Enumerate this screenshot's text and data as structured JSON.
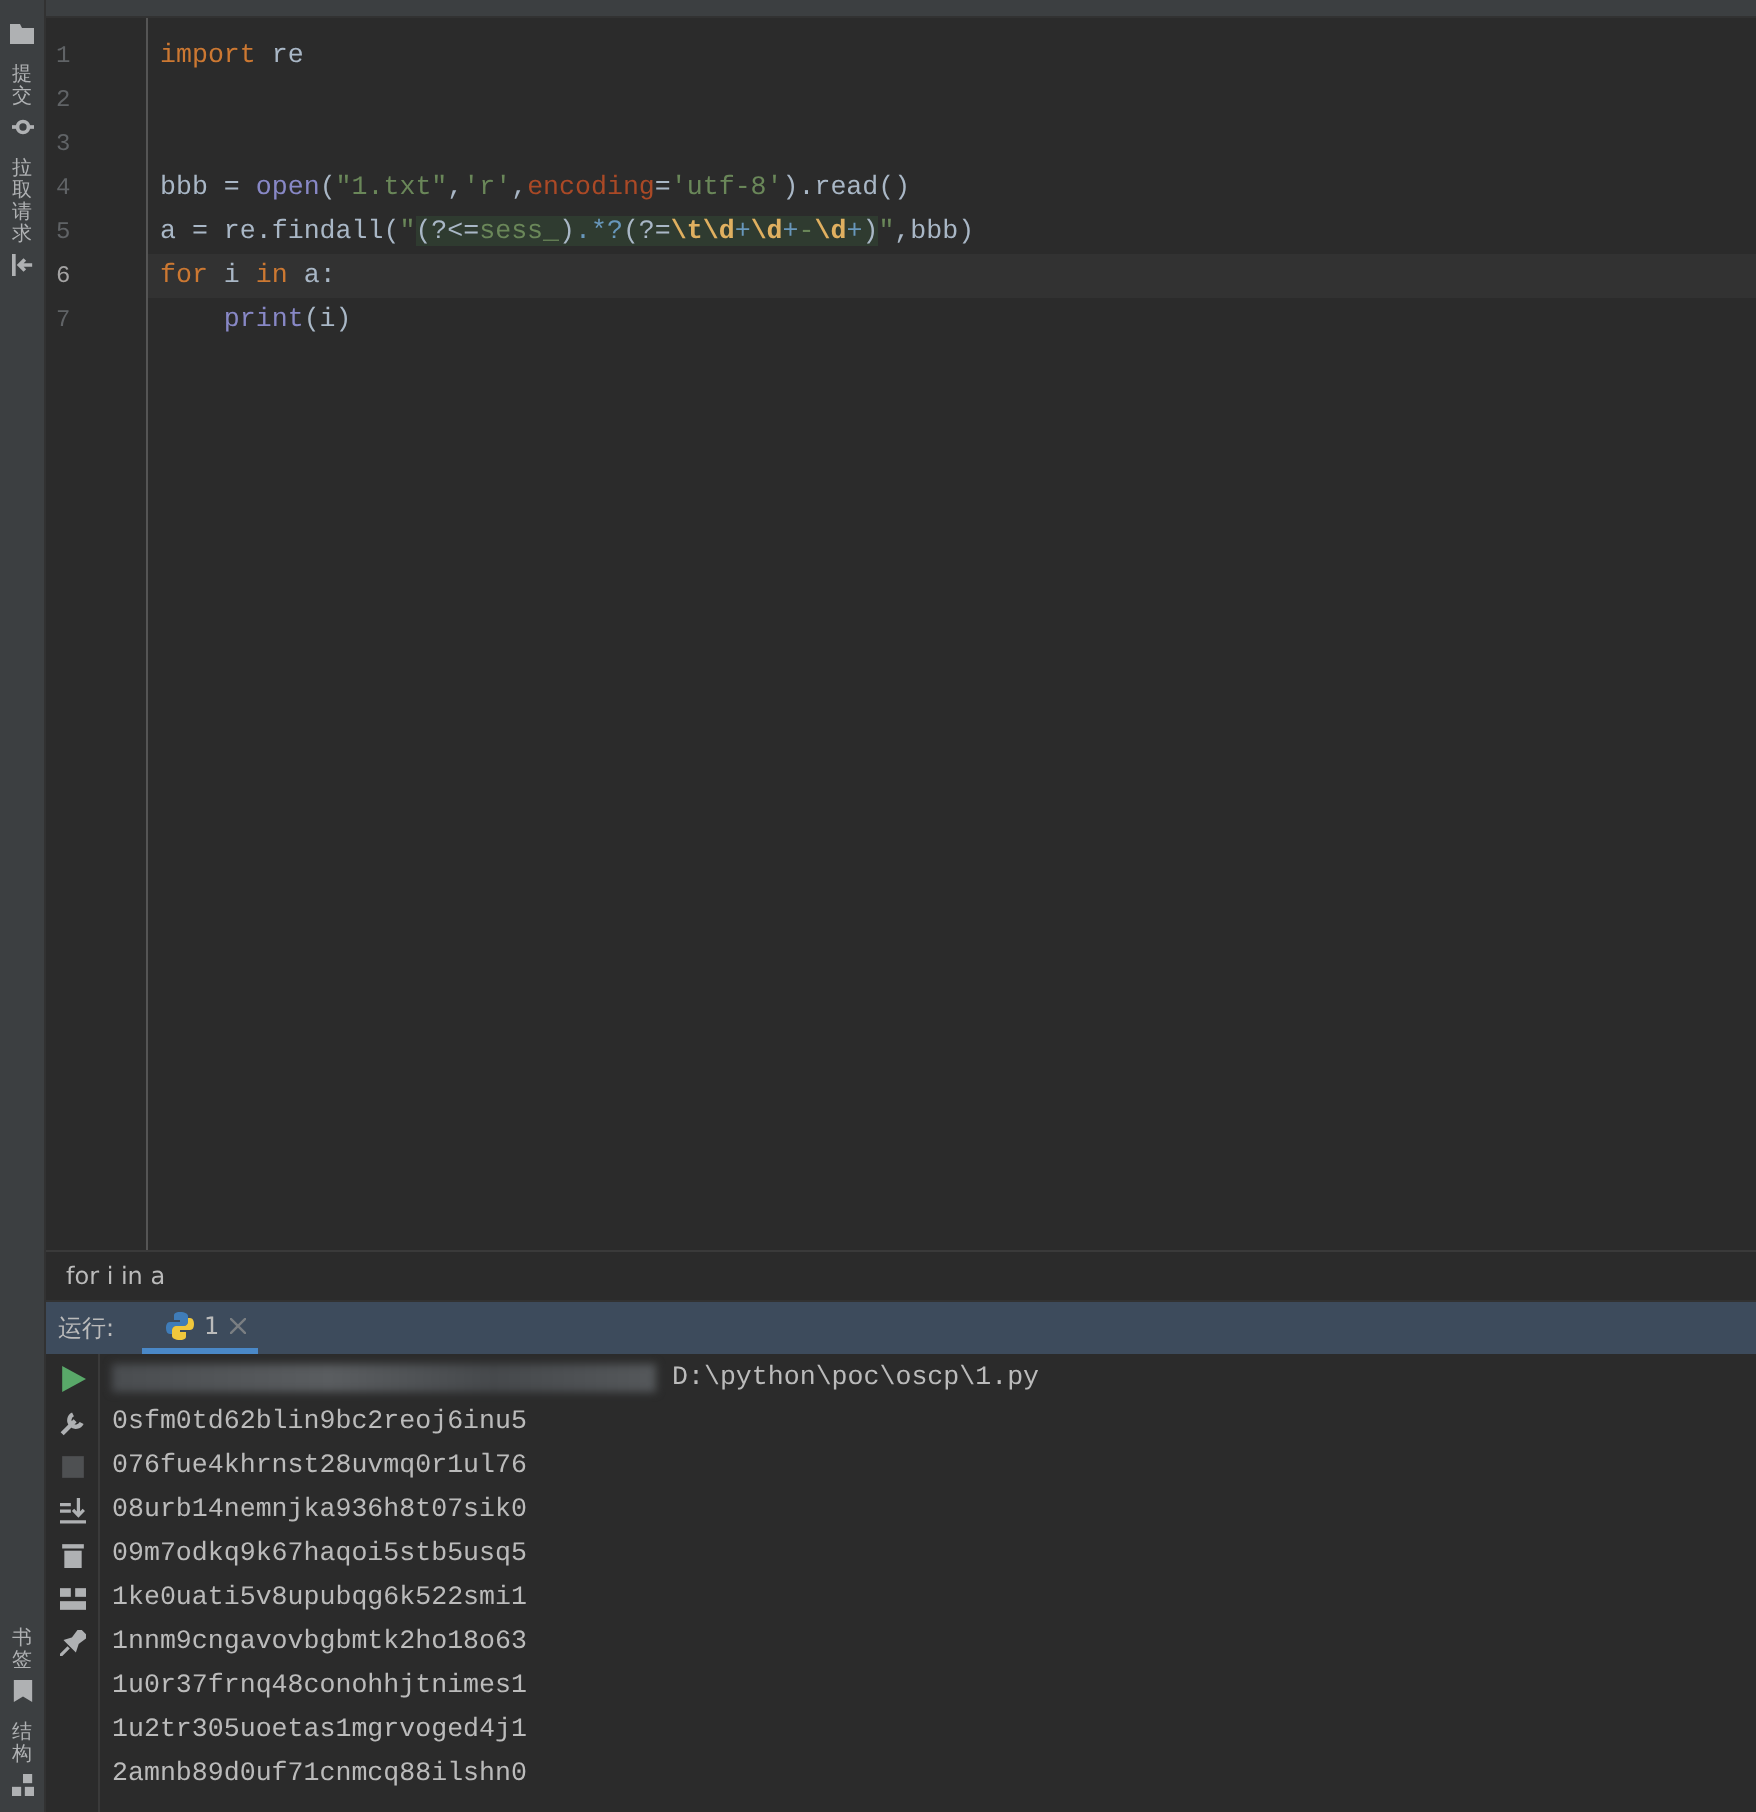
{
  "side_tools": {
    "top": [
      {
        "label": "提交",
        "kind": "commit"
      },
      {
        "label": "拉取请求",
        "kind": "pull"
      }
    ],
    "bottom": [
      {
        "label": "书签",
        "kind": "bookmark"
      },
      {
        "label": "结构",
        "kind": "structure"
      }
    ]
  },
  "editor": {
    "lines": [
      {
        "number": "1",
        "current": false,
        "tokens": [
          {
            "text": "import",
            "kind": "keyword"
          },
          {
            "text": " re",
            "kind": "plain"
          }
        ]
      },
      {
        "number": "2",
        "current": false
      },
      {
        "number": "3",
        "current": false
      },
      {
        "number": "4",
        "current": false,
        "tokens": [
          {
            "text": "bbb = ",
            "kind": "plain"
          },
          {
            "text": "open",
            "kind": "builtin"
          },
          {
            "text": "(",
            "kind": "plain"
          },
          {
            "text": "\"1.txt\"",
            "kind": "string"
          },
          {
            "text": ",",
            "kind": "plain"
          },
          {
            "text": "'r'",
            "kind": "string"
          },
          {
            "text": ",",
            "kind": "plain"
          },
          {
            "text": "encoding",
            "kind": "param"
          },
          {
            "text": "=",
            "kind": "plain"
          },
          {
            "text": "'utf-8'",
            "kind": "string"
          },
          {
            "text": ").read()",
            "kind": "plain"
          }
        ]
      },
      {
        "number": "5",
        "current": false,
        "tokens": [
          {
            "text": "a = re.findall(",
            "kind": "plain"
          },
          {
            "text": "\"",
            "kind": "string"
          },
          {
            "text": "(?<=",
            "kind": "regex-group"
          },
          {
            "text": "sess_",
            "kind": "regex-text"
          },
          {
            "text": ")",
            "kind": "regex-group"
          },
          {
            "text": ".*?",
            "kind": "regex-op"
          },
          {
            "text": "(?=",
            "kind": "regex-group"
          },
          {
            "text": "\\t\\d",
            "kind": "regex-escape"
          },
          {
            "text": "+",
            "kind": "regex-op"
          },
          {
            "text": "\\d",
            "kind": "regex-escape"
          },
          {
            "text": "+",
            "kind": "regex-op"
          },
          {
            "text": "-",
            "kind": "regex-text"
          },
          {
            "text": "\\d",
            "kind": "regex-escape"
          },
          {
            "text": "+",
            "kind": "regex-op"
          },
          {
            "text": ")",
            "kind": "regex-group"
          },
          {
            "text": "\"",
            "kind": "string"
          },
          {
            "text": ",bbb)",
            "kind": "plain"
          }
        ]
      },
      {
        "number": "6",
        "current": true,
        "tokens": [
          {
            "text": "for",
            "kind": "keyword"
          },
          {
            "text": " i ",
            "kind": "plain"
          },
          {
            "text": "in",
            "kind": "keyword"
          },
          {
            "text": " a:",
            "kind": "plain"
          }
        ]
      },
      {
        "number": "7",
        "current": false,
        "tokens": [
          {
            "text": "    print",
            "kind": "builtin"
          },
          {
            "text": "(i)",
            "kind": "plain"
          }
        ]
      }
    ]
  },
  "breadcrumb": "for i in a",
  "run_panel": {
    "label": "运行:",
    "tabs": [
      {
        "label": "1",
        "selected": true
      }
    ],
    "command": "D:\\python\\poc\\oscp\\1.py",
    "output": [
      "0sfm0td62blin9bc2reoj6inu5",
      "076fue4khrnst28uvmq0r1ul76",
      "08urb14nemnjka936h8t07sik0",
      "09m7odkq9k67haqoi5stb5usq5",
      "1ke0uati5v8upubqg6k522smi1",
      "1nnm9cngavovbgbmtk2ho18o63",
      "1u0r37frnq48conohhjtnimes1",
      "1u2tr305uoetas1mgrvoged4j1",
      "2amnb89d0uf71cnmcq88ilshn0"
    ]
  }
}
